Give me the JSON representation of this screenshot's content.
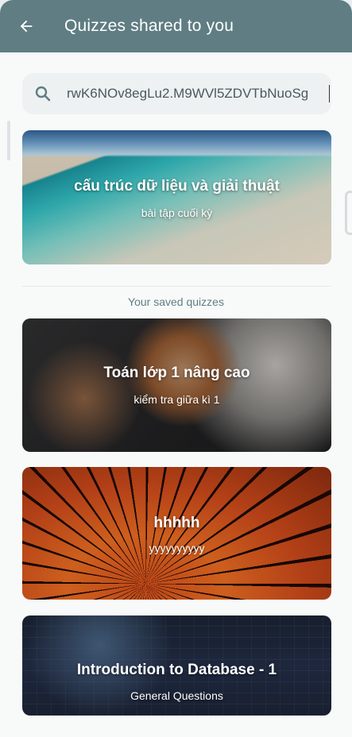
{
  "header": {
    "title": "Quizzes shared to you",
    "back_icon": "arrow-left-icon"
  },
  "search": {
    "icon": "search-icon",
    "value": "rwK6NOv8egLu2.M9WVl5ZDVTbNuoSg"
  },
  "shared_quiz": {
    "title": "cấu trúc dữ liệu và giải thuật",
    "subtitle": "bài tập cuối kỳ"
  },
  "saved_section": {
    "label": "Your saved quizzes"
  },
  "saved_quizzes": [
    {
      "title": "Toán lớp 1 nâng cao",
      "subtitle": "kiểm tra giữa kì 1"
    },
    {
      "title": "hhhhh",
      "subtitle": "yyyyyyyyyy"
    },
    {
      "title": "Introduction to Database - 1",
      "subtitle": "General Questions"
    }
  ],
  "colors": {
    "appbar": "#5f7d83",
    "section_label": "#5f7d83",
    "background": "#f8fafa"
  }
}
